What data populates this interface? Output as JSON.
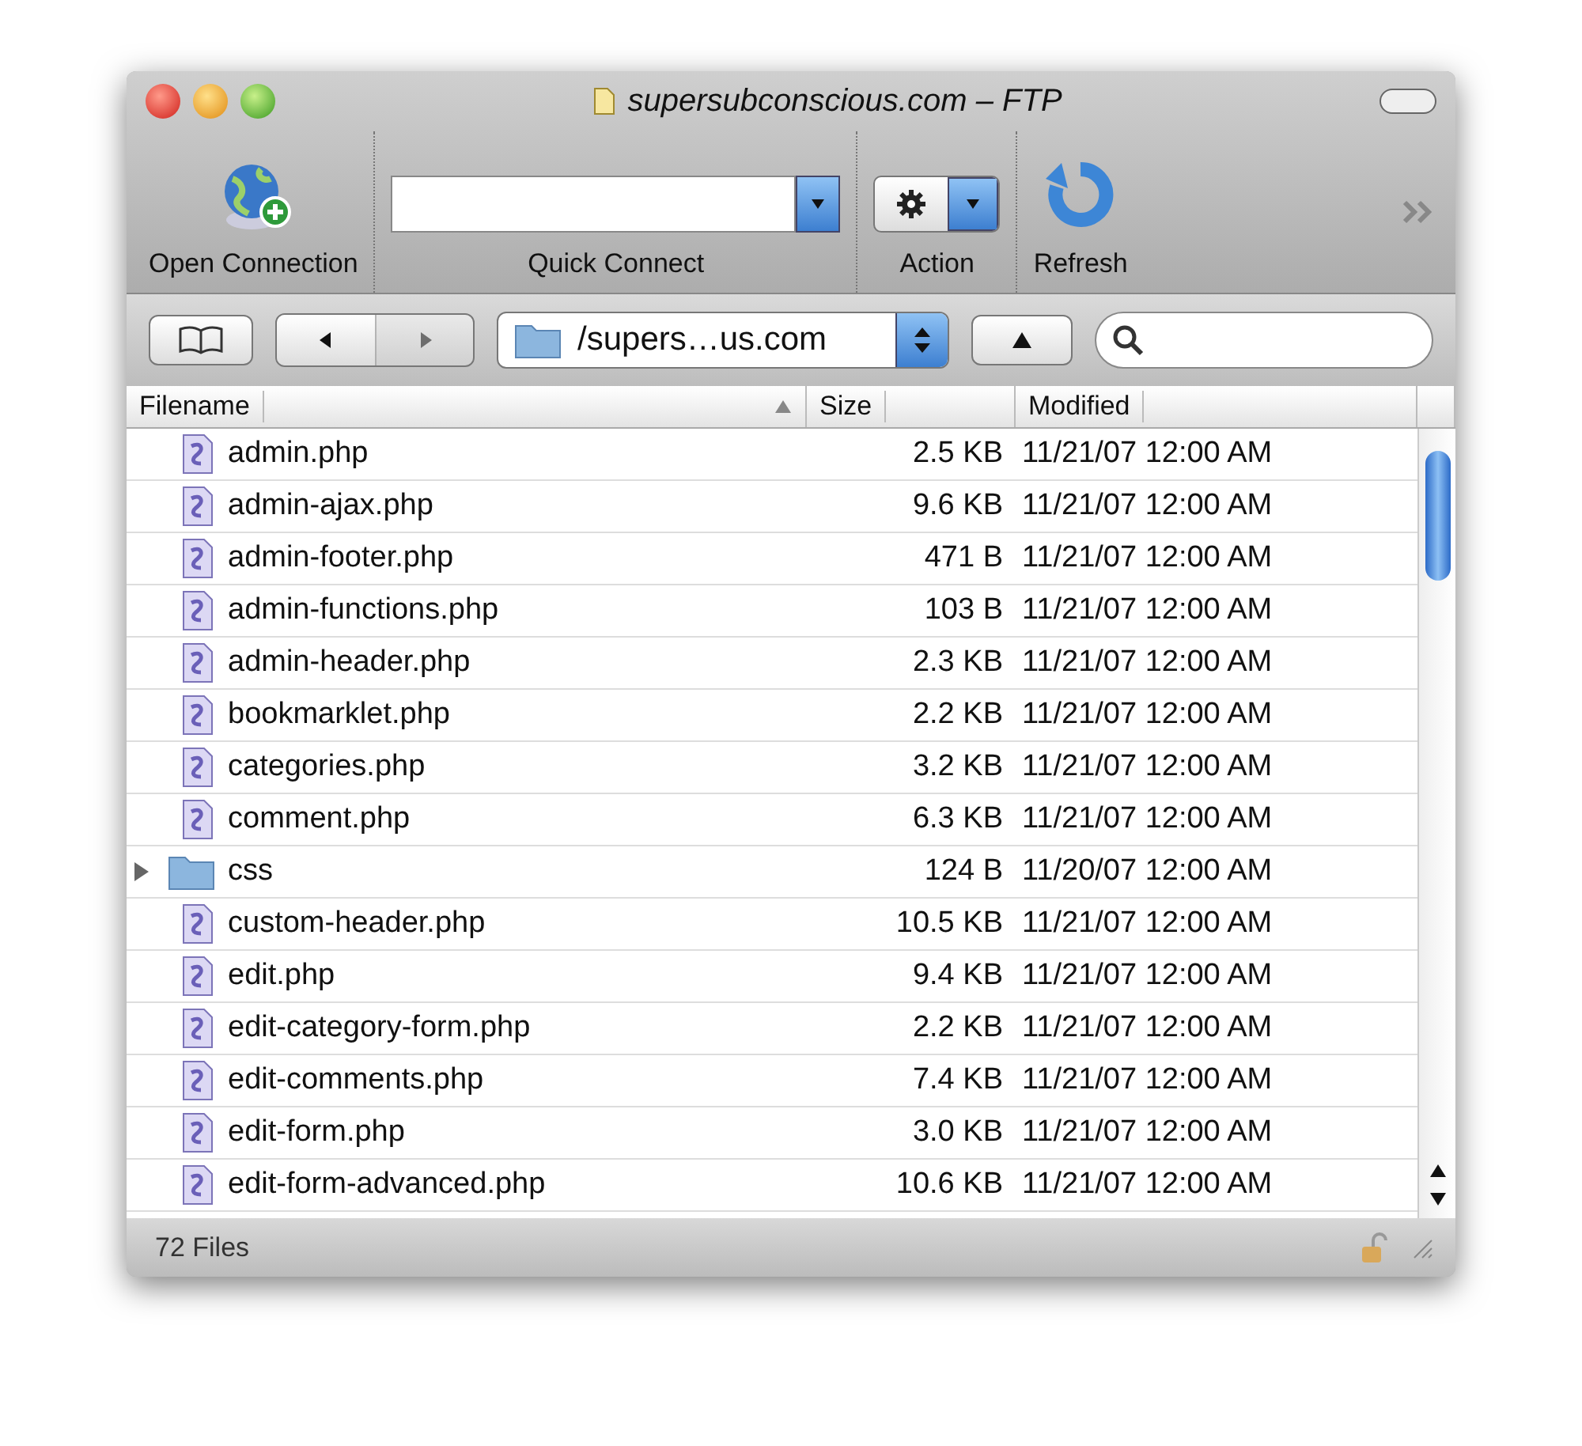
{
  "window": {
    "title": "supersubconscious.com – FTP"
  },
  "toolbar": {
    "items": [
      {
        "kind": "connect",
        "label": "Open Connection"
      },
      {
        "kind": "combo",
        "label": "Quick Connect"
      },
      {
        "kind": "menu",
        "label": "Action"
      },
      {
        "kind": "refresh",
        "label": "Refresh"
      }
    ]
  },
  "path": {
    "value": "/supers…us.com"
  },
  "table": {
    "columns": [
      {
        "label": "Filename",
        "sorted": true
      },
      {
        "label": "Size",
        "sorted": false
      },
      {
        "label": "Modified",
        "sorted": false
      }
    ],
    "rows": [
      {
        "kind": "file",
        "name": "admin.php",
        "size": "2.5 KB",
        "modified": "11/21/07 12:00 AM"
      },
      {
        "kind": "file",
        "name": "admin-ajax.php",
        "size": "9.6 KB",
        "modified": "11/21/07 12:00 AM"
      },
      {
        "kind": "file",
        "name": "admin-footer.php",
        "size": "471 B",
        "modified": "11/21/07 12:00 AM"
      },
      {
        "kind": "file",
        "name": "admin-functions.php",
        "size": "103 B",
        "modified": "11/21/07 12:00 AM"
      },
      {
        "kind": "file",
        "name": "admin-header.php",
        "size": "2.3 KB",
        "modified": "11/21/07 12:00 AM"
      },
      {
        "kind": "file",
        "name": "bookmarklet.php",
        "size": "2.2 KB",
        "modified": "11/21/07 12:00 AM"
      },
      {
        "kind": "file",
        "name": "categories.php",
        "size": "3.2 KB",
        "modified": "11/21/07 12:00 AM"
      },
      {
        "kind": "file",
        "name": "comment.php",
        "size": "6.3 KB",
        "modified": "11/21/07 12:00 AM"
      },
      {
        "kind": "folder",
        "expanded": false,
        "name": "css",
        "size": "124 B",
        "modified": "11/20/07 12:00 AM"
      },
      {
        "kind": "file",
        "name": "custom-header.php",
        "size": "10.5 KB",
        "modified": "11/21/07 12:00 AM"
      },
      {
        "kind": "file",
        "name": "edit.php",
        "size": "9.4 KB",
        "modified": "11/21/07 12:00 AM"
      },
      {
        "kind": "file",
        "name": "edit-category-form.php",
        "size": "2.2 KB",
        "modified": "11/21/07 12:00 AM"
      },
      {
        "kind": "file",
        "name": "edit-comments.php",
        "size": "7.4 KB",
        "modified": "11/21/07 12:00 AM"
      },
      {
        "kind": "file",
        "name": "edit-form.php",
        "size": "3.0 KB",
        "modified": "11/21/07 12:00 AM"
      },
      {
        "kind": "file",
        "name": "edit-form-advanced.php",
        "size": "10.6 KB",
        "modified": "11/21/07 12:00 AM"
      }
    ]
  },
  "status_bar": {
    "text": "72 Files"
  }
}
